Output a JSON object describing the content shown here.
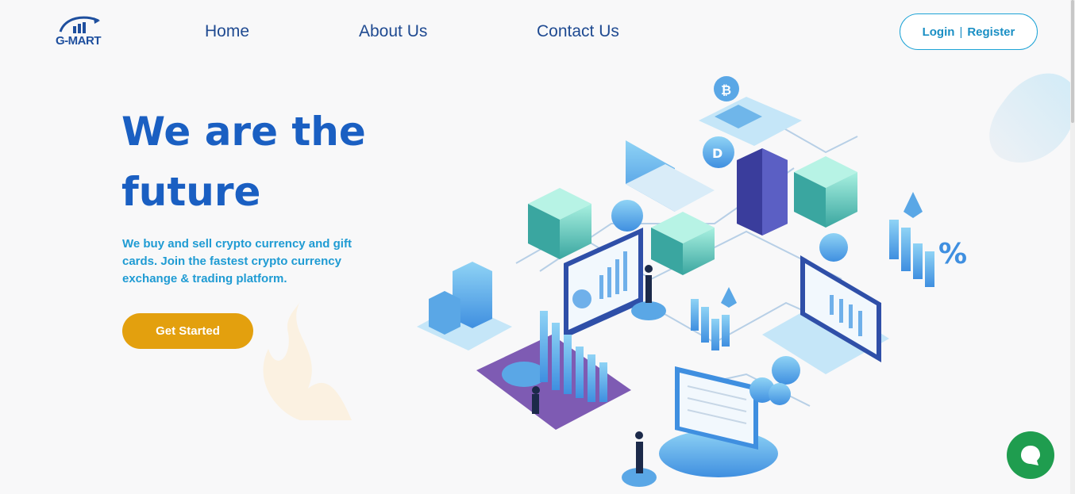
{
  "brand": {
    "name": "G-MART",
    "color": "#1e4f9e"
  },
  "nav": {
    "items": [
      {
        "label": "Home"
      },
      {
        "label": "About Us"
      },
      {
        "label": "Contact Us"
      }
    ],
    "auth": {
      "login": "Login",
      "separator": "|",
      "register": "Register"
    }
  },
  "hero": {
    "title": "We are the future",
    "subtitle": "We buy and sell crypto currency and gift cards. Join the fastest crypto currency exchange & trading platform.",
    "cta": "Get Started"
  },
  "colors": {
    "primary": "#1a5fc2",
    "accent": "#e3a00e",
    "chat": "#1f9d4f",
    "sub": "#1f9bd3"
  },
  "icons": {
    "chat": "chat-bubble-icon",
    "logo": "bar-chart-logo-icon"
  }
}
